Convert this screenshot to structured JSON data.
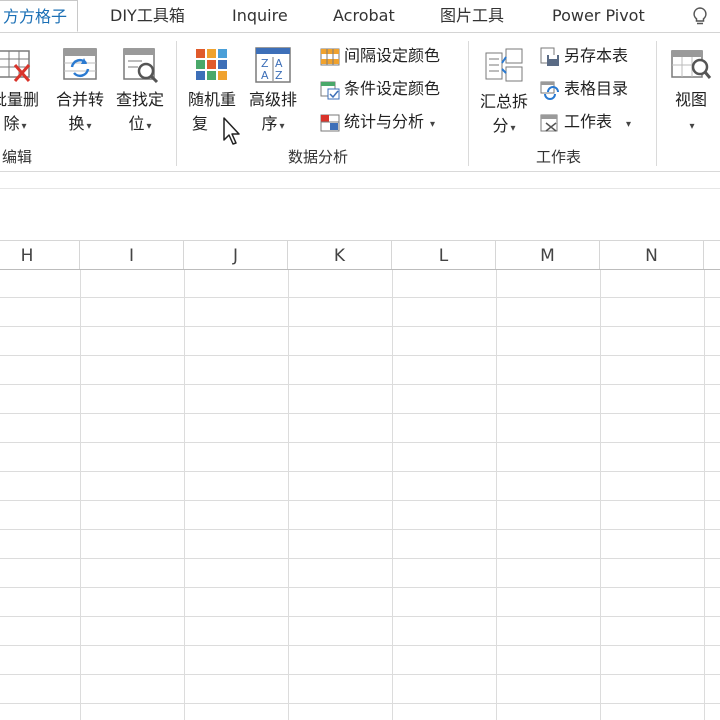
{
  "tabs": [
    {
      "label": "方方格子",
      "active": true
    },
    {
      "label": "DIY工具箱",
      "active": false
    },
    {
      "label": "Inquire",
      "active": false
    },
    {
      "label": "Acrobat",
      "active": false
    },
    {
      "label": "图片工具",
      "active": false
    },
    {
      "label": "Power Pivot",
      "active": false
    }
  ],
  "ribbon": {
    "edit_group": {
      "label": "编辑",
      "buttons": [
        {
          "line1": "批量删",
          "line2": "除",
          "icon": "batch-delete-icon"
        },
        {
          "line1": "合并转",
          "line2": "换",
          "icon": "merge-convert-icon"
        },
        {
          "line1": "查找定",
          "line2": "位",
          "icon": "find-locate-icon"
        }
      ]
    },
    "analysis_group": {
      "label": "数据分析",
      "buttons": [
        {
          "line1": "随机重",
          "line2": "复",
          "icon": "random-repeat-icon"
        },
        {
          "line1": "高级排",
          "line2": "序",
          "icon": "advanced-sort-icon"
        }
      ],
      "small_buttons": [
        {
          "label": "间隔设定颜色",
          "icon": "interval-color-icon"
        },
        {
          "label": "条件设定颜色",
          "icon": "condition-color-icon"
        },
        {
          "label": "统计与分析",
          "icon": "statistics-icon"
        }
      ]
    },
    "worksheet_group": {
      "label": "工作表",
      "big_button": {
        "line1": "汇总拆",
        "line2": "分",
        "icon": "summary-split-icon"
      },
      "small_buttons": [
        {
          "label": "另存本表",
          "icon": "save-sheet-icon"
        },
        {
          "label": "表格目录",
          "icon": "table-directory-icon"
        },
        {
          "label": "工作表",
          "icon": "worksheet-icon"
        }
      ]
    },
    "view_group": {
      "button": {
        "line1": "视图",
        "icon": "view-icon"
      }
    }
  },
  "columns": [
    "H",
    "I",
    "J",
    "K",
    "L",
    "M",
    "N"
  ],
  "colors": {
    "accent": "#1a6fb5",
    "grid": "#dcdcdc",
    "active_tab_text": "#1a6fb5"
  }
}
